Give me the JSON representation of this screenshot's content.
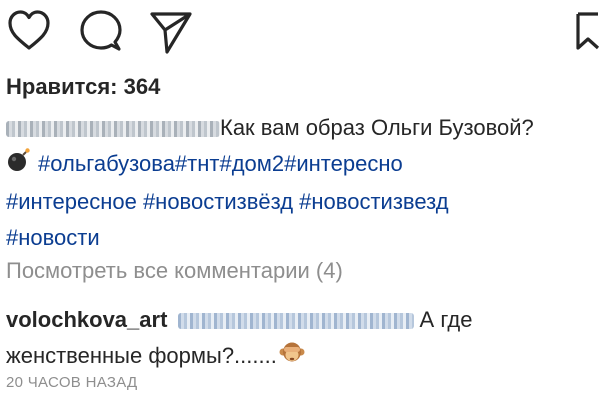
{
  "actions": {
    "like_icon": "heart-outline",
    "comment_icon": "speech-bubble",
    "share_icon": "paper-plane",
    "save_icon": "bookmark"
  },
  "post": {
    "likes_text": "Нравится: 364",
    "caption_text": "Как вам образ Ольги Бузовой?",
    "hashtags_line1": "#ольгабузова#тнт#дом2#интересно",
    "hashtags_line2": "#интересное #новостизвёзд #новостизвезд",
    "hashtags_line3": "#новости",
    "view_all_comments": "Посмотреть все комментарии (4)"
  },
  "comment": {
    "username": "volochkova_art",
    "text_part1": "А где",
    "text_part2": "женственные формы?......."
  },
  "timestamp": "20 ЧАСОВ НАЗАД"
}
